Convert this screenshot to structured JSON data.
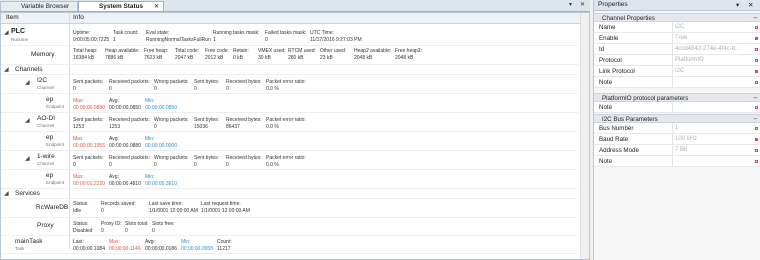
{
  "tabs": {
    "variable_browser": "Variable Browser",
    "system_status": "System Status"
  },
  "window_controls": {
    "pin": "▾",
    "close": "✕"
  },
  "columns": {
    "item": "Item",
    "info": "Info"
  },
  "plc": {
    "name": "PLC",
    "sub": "Runtime",
    "fields": [
      [
        "Uptime:",
        "0:00:05:00:7225"
      ],
      [
        "Task count:",
        "1"
      ],
      [
        "Eval state:",
        "RunningNormalTasksFullRun"
      ],
      [
        "Running tasks mask:",
        "1"
      ],
      [
        "Failed tasks mask:",
        "0"
      ],
      [
        "UTC Time:",
        "11/17/2016 9:27:03 PM"
      ]
    ]
  },
  "memory": {
    "name": "Memory",
    "fields": [
      [
        "Total heap:",
        "16384 kB"
      ],
      [
        "Heap available:",
        "7886 kB"
      ],
      [
        "Free heap:",
        "7623 kB"
      ],
      [
        "Total code:",
        "2047 kB"
      ],
      [
        "Free code:",
        "2012 kB"
      ],
      [
        "Retain:",
        "0 kB"
      ],
      [
        "VMEX used:",
        "30 kB"
      ],
      [
        "RTCM used:",
        "280 kB"
      ],
      [
        "Other used:",
        "23 kB"
      ],
      [
        "Heap2 available:",
        "2048 kB"
      ],
      [
        "Free heap2:",
        "2048 kB"
      ]
    ]
  },
  "channels": {
    "name": "Channels",
    "i2c": {
      "name": "I2C",
      "sub": "Channel",
      "fields": [
        [
          "Sent packets:",
          "0"
        ],
        [
          "Received packets:",
          "0"
        ],
        [
          "Wrong packets:",
          "0"
        ],
        [
          "Sent bytes:",
          "0"
        ],
        [
          "Received bytes:",
          "0"
        ],
        [
          "Packet error ratio:",
          "0.0 %"
        ]
      ]
    },
    "i2c_ep": {
      "name": "ep",
      "sub": "Endpoint",
      "max_label": "Max:",
      "max": "00:00:00.0880",
      "avg_label": "Avg:",
      "avg": "00:00:00.0850",
      "min_label": "Min:",
      "min": "00:00:00.0850"
    },
    "aodi": {
      "name": "AO-DI",
      "sub": "Channel",
      "fields": [
        [
          "Sent packets:",
          "1253"
        ],
        [
          "Received packets:",
          "1253"
        ],
        [
          "Wrong packets:",
          "0"
        ],
        [
          "Sent bytes:",
          "15036"
        ],
        [
          "Received bytes:",
          "86437"
        ],
        [
          "Packet error ratio:",
          "0.0 %"
        ]
      ]
    },
    "aodi_ep": {
      "name": "ep",
      "sub": "Endpoint",
      "max_label": "Max:",
      "max": "00:00:00.1955",
      "avg_label": "Avg:",
      "avg": "00:00:00.0880",
      "min_label": "Min:",
      "min": "00:00:00.0000"
    },
    "onewire": {
      "name": "1-wire",
      "sub": "Channel",
      "fields": [
        [
          "Sent packets:",
          "0"
        ],
        [
          "Received packets:",
          "0"
        ],
        [
          "Wrong packets:",
          "0"
        ],
        [
          "Sent bytes:",
          "0"
        ],
        [
          "Received bytes:",
          "0"
        ],
        [
          "Packet error ratio:",
          "0.0 %"
        ]
      ]
    },
    "onewire_ep": {
      "name": "ep",
      "sub": "Endpoint",
      "max_label": "Max:",
      "max": "00:00:01.2220",
      "avg_label": "Avg:",
      "avg": "00:00:00.4810",
      "min_label": "Min:",
      "min": "00:00:00.3610"
    }
  },
  "services": {
    "name": "Services",
    "rcware": {
      "name": "RcWareDB",
      "fields": [
        [
          "Status:",
          "Idle"
        ],
        [
          "Records saved:",
          "0"
        ],
        [
          "Last save time:",
          "1/1/0001 12:00:00 AM"
        ],
        [
          "Last request time:",
          "1/1/0001 12:00:00 AM"
        ]
      ]
    },
    "proxy": {
      "name": "Proxy",
      "fields": [
        [
          "Status:",
          "Disabled"
        ],
        [
          "Proxy ID:",
          "0"
        ],
        [
          "Slots total:",
          "0"
        ],
        [
          "Slots free:",
          "0"
        ]
      ]
    }
  },
  "maintask": {
    "name": "mainTask",
    "sub": "Task",
    "last_label": "Last:",
    "last": "00:00:00.1084",
    "max_label": "Max:",
    "max": "00:00:00.1146",
    "avg_label": "Avg:",
    "avg": "00:00:00.0186",
    "min_label": "Min:",
    "min": "00:00:00.0058",
    "count_label": "Count:",
    "count": "11217"
  },
  "properties": {
    "title": "Properties",
    "section1": "Channel Properties",
    "rows1": [
      {
        "k": "Name",
        "v": "I2C"
      },
      {
        "k": "Enable",
        "v": "True"
      },
      {
        "k": "Id",
        "v": "4ccd4842-274e-4f4c-b..."
      },
      {
        "k": "Protocol",
        "v": "PlatformIO"
      },
      {
        "k": "Link Protocol",
        "v": "I2C"
      },
      {
        "k": "Note",
        "v": ""
      }
    ],
    "section2": "PlatformIO protocol parameters",
    "rows2": [
      {
        "k": "Note",
        "v": ""
      }
    ],
    "section3": "I2C Bus Parameters",
    "rows3": [
      {
        "k": "Bus Number",
        "v": "1"
      },
      {
        "k": "Baud Rate",
        "v": "100 kHz"
      },
      {
        "k": "Address Mode",
        "v": "7 Bit"
      },
      {
        "k": "Note",
        "v": ""
      }
    ],
    "minus": "−",
    "colors": {
      "modified_marker": "#e24a4a",
      "accent_blue": "#2f8fd6",
      "max_red": "#e0553d"
    }
  }
}
